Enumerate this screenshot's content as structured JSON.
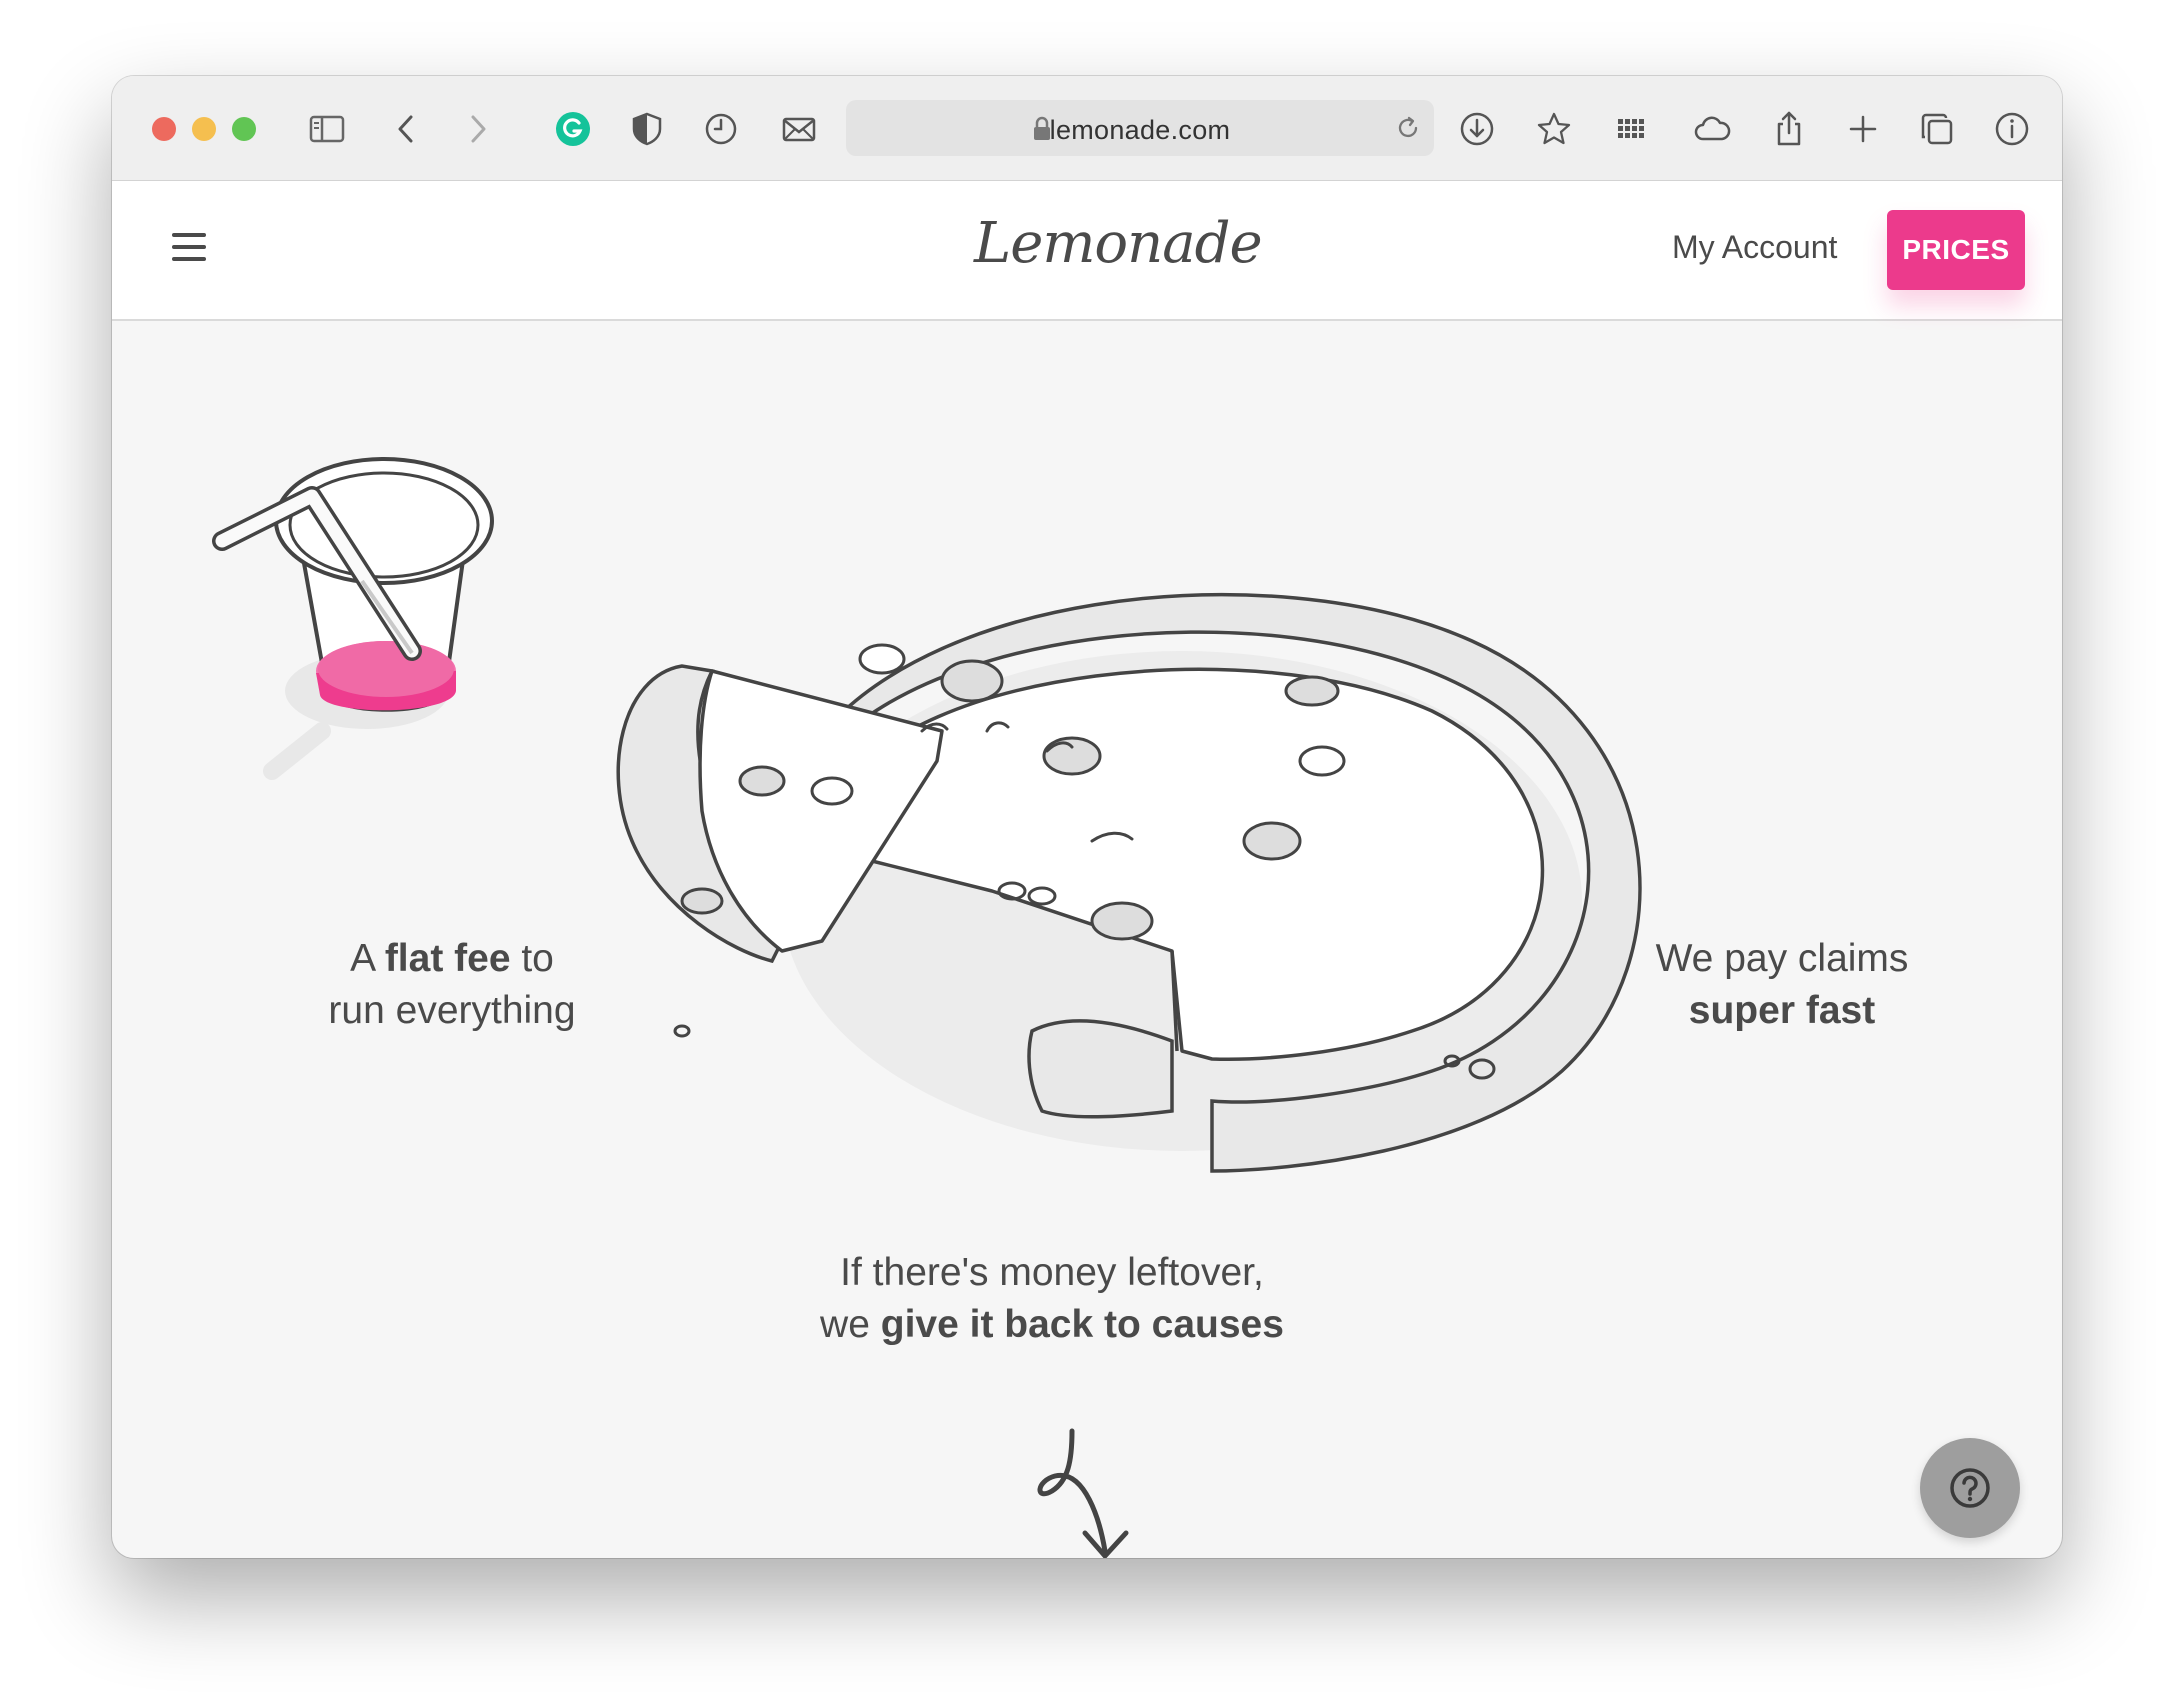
{
  "browser": {
    "url": "lemonade.com",
    "icons": [
      "sidebar-icon",
      "back-icon",
      "forward-icon",
      "grammarly-icon",
      "shield-icon",
      "clock-icon",
      "mail-icon",
      "lock-icon",
      "reload-icon",
      "download-icon",
      "star-icon",
      "grid-icon",
      "cloud-icon",
      "share-icon",
      "plus-icon",
      "tabs-icon",
      "info-icon"
    ]
  },
  "header": {
    "logo": "Lemonade",
    "my_account": "My Account",
    "prices": "PRICES"
  },
  "captions": {
    "left_pre": "A ",
    "left_bold": "flat fee",
    "left_post": " to",
    "left_line2": "run everything",
    "right_line1": "We pay claims",
    "right_bold": "super fast",
    "bottom_line1": "If there's money leftover,",
    "bottom_pre": "we ",
    "bottom_bold": "give it back to causes"
  },
  "colors": {
    "accent": "#ec3a8c",
    "text": "#4a4a4a",
    "background": "#f6f6f6"
  }
}
